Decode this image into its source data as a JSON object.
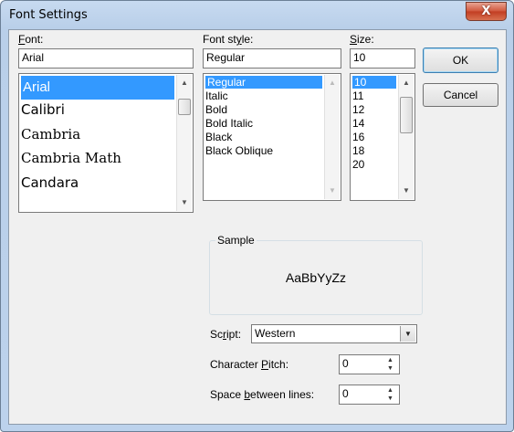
{
  "window": {
    "title": "Font Settings",
    "close_label": "X"
  },
  "font": {
    "label_prefix": "",
    "label_hot": "F",
    "label_rest": "ont:",
    "value": "Arial",
    "items": [
      "Arial",
      "Calibri",
      "Cambria",
      "Cambria Math",
      "Candara"
    ],
    "selected_index": 0
  },
  "style": {
    "label_prefix": "Font st",
    "label_hot": "y",
    "label_rest": "le:",
    "value": "Regular",
    "items": [
      "Regular",
      "Italic",
      "Bold",
      "Bold Italic",
      "Black",
      "Black Oblique"
    ],
    "selected_index": 0
  },
  "size": {
    "label_prefix": "",
    "label_hot": "S",
    "label_rest": "ize:",
    "value": "10",
    "items": [
      "10",
      "11",
      "12",
      "14",
      "16",
      "18",
      "20"
    ],
    "selected_index": 0
  },
  "buttons": {
    "ok": "OK",
    "cancel": "Cancel"
  },
  "sample": {
    "legend": "Sample",
    "text": "AaBbYyZz"
  },
  "script": {
    "label_prefix": "Sc",
    "label_hot": "r",
    "label_rest": "ipt:",
    "value": "Western"
  },
  "pitch": {
    "label_prefix": "Character ",
    "label_hot": "P",
    "label_rest": "itch:",
    "value": "0"
  },
  "spacing": {
    "label_prefix": "Space ",
    "label_hot": "b",
    "label_rest": "etween lines:",
    "value": "0"
  },
  "icons": {
    "scroll_up": "▲",
    "scroll_down": "▼",
    "combo": "▼"
  }
}
